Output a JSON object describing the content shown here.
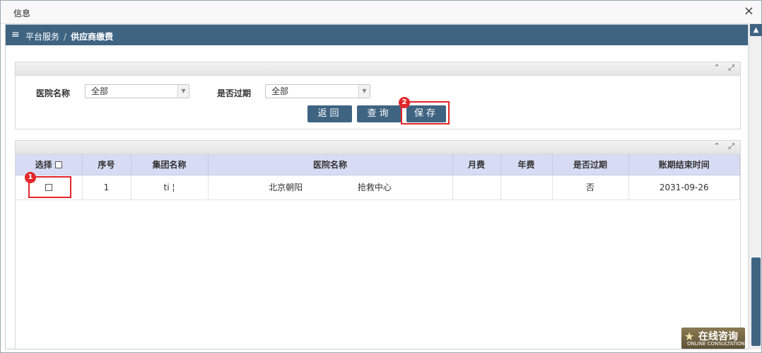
{
  "dialog": {
    "title": "信息",
    "close": "×"
  },
  "topbar": {
    "menu_icon": "≡",
    "crumb_root": "平台服务",
    "crumb_sep": "/",
    "crumb_current": "供应商缴费"
  },
  "panel_tools": {
    "collapse": "⌃",
    "expand": "⤢"
  },
  "filters": {
    "hospital_label": "医院名称",
    "hospital_value": "全部",
    "expired_label": "是否过期",
    "expired_value": "全部"
  },
  "buttons": {
    "back": "返回",
    "query": "查询",
    "save": "保存"
  },
  "annotations": {
    "one": "1",
    "two": "2"
  },
  "table": {
    "headers": [
      "选择",
      "序号",
      "集团名称",
      "医院名称",
      "月费",
      "年费",
      "是否过期",
      "账期结束时间"
    ],
    "rows": [
      {
        "index": "1",
        "group": "ti      ¦",
        "hospital_a": "北京朝阳",
        "hospital_b": "抢救中心",
        "monthly": "",
        "yearly": "",
        "expired": "否",
        "end_date": "2031-09-26"
      }
    ]
  },
  "ad": {
    "text": "在线咨询",
    "sub": "ONLINE CONSULTATION"
  }
}
